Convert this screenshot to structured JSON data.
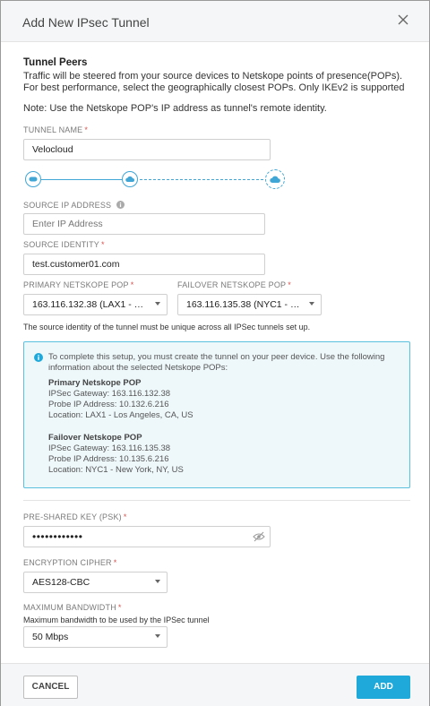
{
  "dialog": {
    "title": "Add New IPsec Tunnel"
  },
  "tunnel_peers": {
    "heading": "Tunnel Peers",
    "description": "Traffic will be steered from your source devices to Netskope points of presence(POPs). For best performance, select the geographically closest POPs. Only IKEv2 is supported",
    "note": "Note: Use the Netskope POP's IP address as tunnel's remote identity."
  },
  "tunnel_name": {
    "label": "TUNNEL NAME",
    "required_mark": "*",
    "value": "Velocloud"
  },
  "source_ip": {
    "label": "SOURCE IP ADDRESS",
    "placeholder": "Enter IP Address"
  },
  "source_identity": {
    "label": "SOURCE IDENTITY",
    "required_mark": "*",
    "value": "test.customer01.com"
  },
  "primary_pop": {
    "label": "PRIMARY NETSKOPE POP",
    "required_mark": "*",
    "value": "163.116.132.38 (LAX1 - Los Angeles, CA, US)"
  },
  "failover_pop": {
    "label": "FAILOVER NETSKOPE POP",
    "required_mark": "*",
    "value": "163.116.135.38 (NYC1 - New York, NY, US)"
  },
  "uniqueness_note": "The source identity of the tunnel must be unique across all IPSec tunnels set up.",
  "info": {
    "intro": "To complete this setup, you must create the tunnel on your peer device. Use the following information about the selected Netskope POPs:",
    "primary": {
      "heading": "Primary Netskope POP",
      "gateway": "IPSec Gateway: 163.116.132.38",
      "probe": "Probe IP Address: 10.132.6.216",
      "location": "Location: LAX1 - Los Angeles, CA, US"
    },
    "failover": {
      "heading": "Failover Netskope POP",
      "gateway": "IPSec Gateway: 163.116.135.38",
      "probe": "Probe IP Address: 10.135.6.216",
      "location": "Location: NYC1 - New York, NY, US"
    }
  },
  "psk": {
    "label": "PRE-SHARED KEY (PSK)",
    "required_mark": "*",
    "value": "••••••••••••"
  },
  "cipher": {
    "label": "ENCRYPTION CIPHER",
    "required_mark": "*",
    "value": "AES128-CBC"
  },
  "bandwidth": {
    "label": "MAXIMUM BANDWIDTH",
    "required_mark": "*",
    "helper": "Maximum bandwidth to be used by the IPSec tunnel",
    "value": "50 Mbps"
  },
  "footer": {
    "cancel_label": "CANCEL",
    "add_label": "ADD"
  },
  "colors": {
    "accent": "#1fa9db",
    "info_border": "#5bc0de",
    "info_bg": "#eef8fb",
    "required": "#d9534f"
  }
}
